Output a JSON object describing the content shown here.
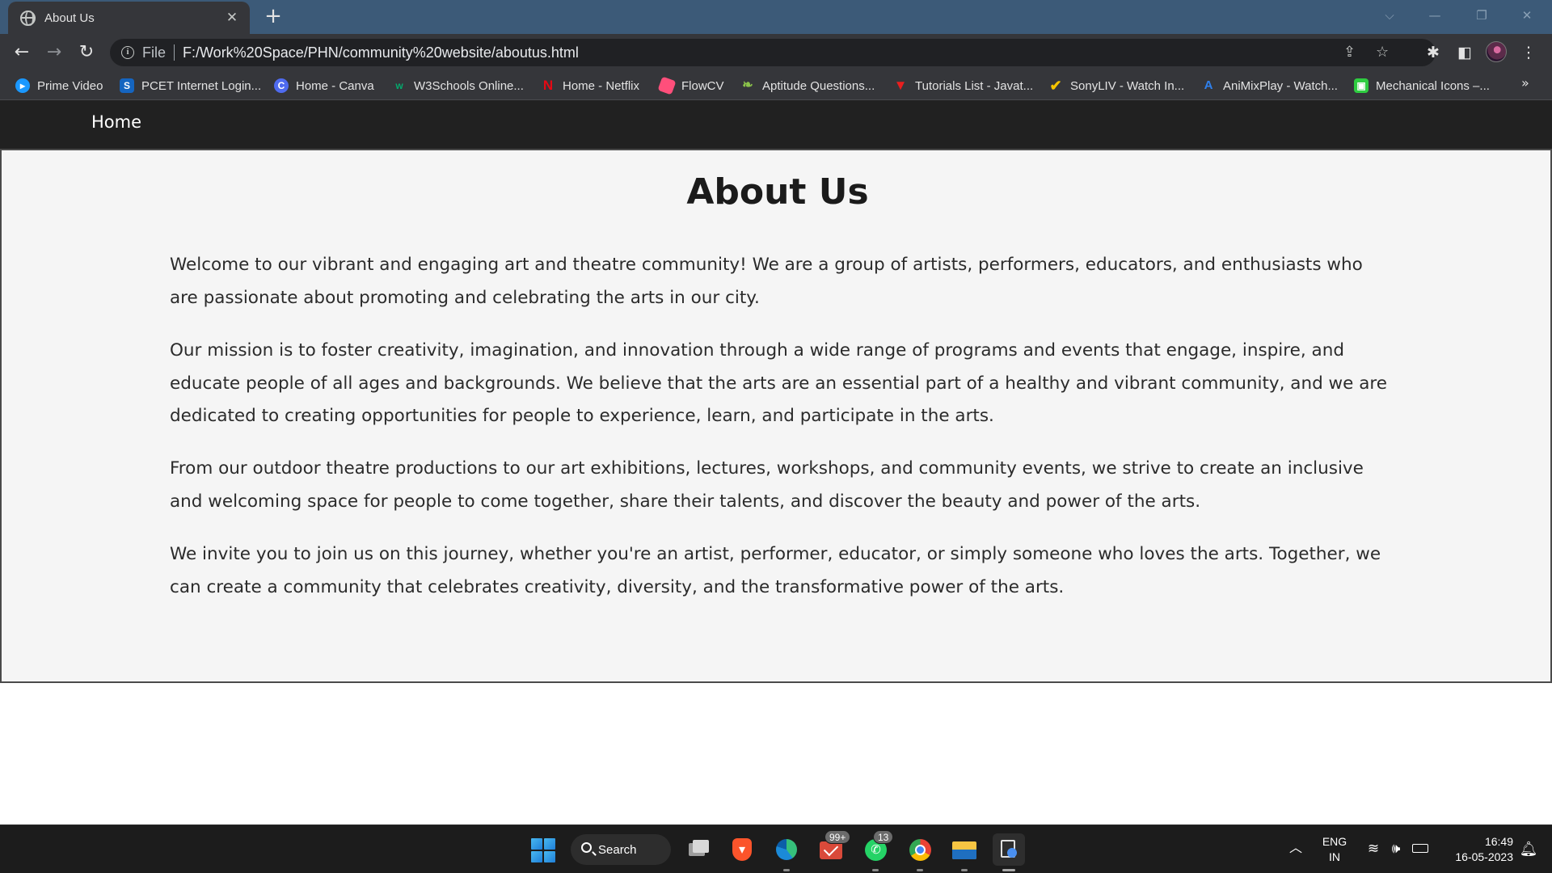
{
  "browser": {
    "tab_title": "About Us",
    "tab_close": "✕",
    "new_tab": "+",
    "address_scheme": "File",
    "address_url": "F:/Work%20Space/PHN/community%20website/aboutus.html",
    "bookmarks": [
      {
        "label": "Prime Video",
        "icon": "prime-video-icon",
        "color": "#1a98ff"
      },
      {
        "label": "PCET Internet Login...",
        "icon": "pcet-icon",
        "color": "#1565c0"
      },
      {
        "label": "Home - Canva",
        "icon": "canva-icon",
        "color": "#00c4cc"
      },
      {
        "label": "W3Schools Online...",
        "icon": "w3schools-icon",
        "color": "#04aa6d"
      },
      {
        "label": "Home - Netflix",
        "icon": "netflix-icon",
        "color": "#e50914"
      },
      {
        "label": "FlowCV",
        "icon": "flowcv-icon",
        "color": "#ff4f7b"
      },
      {
        "label": "Aptitude Questions...",
        "icon": "aptitude-icon",
        "color": "#7cb342"
      },
      {
        "label": "Tutorials List - Javat...",
        "icon": "javatpoint-icon",
        "color": "#e91e1e"
      },
      {
        "label": "SonyLIV - Watch In...",
        "icon": "sonyliv-icon",
        "color": "#f5c400"
      },
      {
        "label": "AniMixPlay - Watch...",
        "icon": "animixplay-icon",
        "color": "#2f80ed"
      },
      {
        "label": "Mechanical Icons –...",
        "icon": "mechanical-icons-icon",
        "color": "#2ecc40"
      }
    ],
    "bookmarks_more": "»"
  },
  "site": {
    "nav_home": "Home",
    "heading": "About Us",
    "paragraphs": [
      "Welcome to our vibrant and engaging art and theatre community! We are a group of artists, performers, educators, and enthusiasts who are passionate about promoting and celebrating the arts in our city.",
      "Our mission is to foster creativity, imagination, and innovation through a wide range of programs and events that engage, inspire, and educate people of all ages and backgrounds. We believe that the arts are an essential part of a healthy and vibrant community, and we are dedicated to creating opportunities for people to experience, learn, and participate in the arts.",
      "From our outdoor theatre productions to our art exhibitions, lectures, workshops, and community events, we strive to create an inclusive and welcoming space for people to come together, share their talents, and discover the beauty and power of the arts.",
      "We invite you to join us on this journey, whether you're an artist, performer, educator, or simply someone who loves the arts. Together, we can create a community that celebrates creativity, diversity, and the transformative power of the arts."
    ]
  },
  "taskbar": {
    "search_label": "Search",
    "mail_badge": "99+",
    "whatsapp_badge": "13",
    "language_line1": "ENG",
    "language_line2": "IN",
    "time": "16:49",
    "date": "16-05-2023"
  },
  "colors": {
    "tab_strip": "#3c5a78",
    "toolbar": "#35363a",
    "site_nav": "#212121",
    "content_bg": "#f5f5f5",
    "taskbar": "#1c1c1c"
  }
}
